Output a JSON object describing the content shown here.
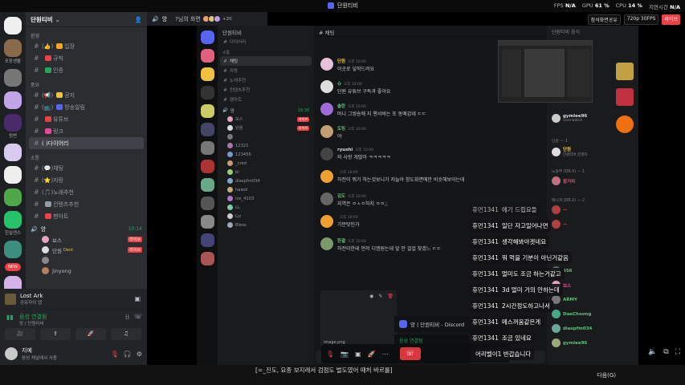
{
  "window": {
    "title": "단원티비"
  },
  "perf": {
    "fps_label": "FPS",
    "fps_value": "N/A",
    "gpu_label": "GPU",
    "gpu_value": "61 %",
    "cpu_label": "CPU",
    "cpu_value": "14 %",
    "latency_label": "지연시간",
    "latency_value": "N/A"
  },
  "stream_overlay": {
    "pill1": "참석화면공유",
    "quality": "720p 30FPS",
    "live": "라이브"
  },
  "left": {
    "server_name": "단원티비",
    "categories": [
      {
        "label": "환영",
        "channels": [
          {
            "name": "입장",
            "prefix": "(👍)"
          },
          {
            "name": "규칙",
            "prefix": ""
          },
          {
            "name": "인증",
            "prefix": ""
          }
        ]
      },
      {
        "label": "중요",
        "channels": [
          {
            "name": "공지",
            "prefix": "(📢)"
          },
          {
            "name": "방송알림",
            "prefix": "(📺)"
          },
          {
            "name": "유튜브",
            "prefix": ""
          },
          {
            "name": "링크",
            "prefix": ""
          },
          {
            "name": "다이어리",
            "prefix": "( )"
          }
        ]
      },
      {
        "label": "소통",
        "channels": [
          {
            "name": "채팅",
            "prefix": "(💬)"
          },
          {
            "name": "자랑",
            "prefix": "(⭐)"
          },
          {
            "name": "노래추천",
            "prefix": "(🎵)"
          },
          {
            "name": "컨텐츠추천",
            "prefix": ""
          },
          {
            "name": "팬아트",
            "prefix": ""
          }
        ]
      }
    ],
    "voice_channel": {
      "name": "앙",
      "time": "10:14"
    },
    "voice_members": [
      {
        "name": "보스",
        "live": "라이브"
      },
      {
        "name": "단원",
        "tag": "Dent",
        "live": "라이브"
      },
      {
        "name": "",
        "live": ""
      },
      {
        "name": "jinyong",
        "live": ""
      }
    ],
    "server_labels": [
      "포장생활",
      "림변",
      "힌실엔스"
    ],
    "new_badge": "NEW"
  },
  "activity": {
    "game": "Lost Ark",
    "status": "공유자의 앱",
    "voice_title": "음성 연결됨",
    "voice_sub": "앙 / 단원티비"
  },
  "user": {
    "name": "지예",
    "status": "음성 채널에서 사용"
  },
  "tab": {
    "title": "앙",
    "streamer": "?님의 화면",
    "count": "+20"
  },
  "stream": {
    "server_name": "단원티비",
    "channels_top": [
      "다이어리"
    ],
    "cat_label": "소통",
    "channels": [
      "채팅",
      "자랑",
      "노래추천",
      "컨텐츠추천",
      "팬아트"
    ],
    "voice_name": "앙",
    "voice_time": "19:38",
    "voice_members": [
      "보스",
      "단원",
      "",
      "12321",
      "123456",
      "_cred",
      "bi",
      "diaspfm034",
      "hawol",
      "ice_4103",
      "LL",
      "Liz",
      "Bless"
    ],
    "chat_header": "채팅",
    "messages": [
      {
        "name": "단원",
        "time": "오후 10:00",
        "text": "이곳로 넣작드려요"
      },
      {
        "name": "슈",
        "time": "오후 10:00",
        "text": "단원 유튜브 구독과 좋아요"
      },
      {
        "name": "솔란",
        "time": "오후 10:00",
        "text": "머니 그씽숑에 지 핸서바는 또 동예갑네 ㄷㄷ"
      },
      {
        "name": "도밍",
        "time": "오후 10:00",
        "text": "야"
      },
      {
        "name": "ryushi",
        "time": "오후 10:00",
        "text": "와 사랑 개많아 ㅋㅋㅋㅋㅋ"
      },
      {
        "name": "",
        "time": "오후 10:00",
        "text": "하전이 뭐가 하는것보니가 저늘야 창도화면에만 비슷해보이는데"
      },
      {
        "name": "김도",
        "time": "오후 10:00",
        "text": "지역은 ㅇㅅㅇ하지 ㅇㅇ;;"
      },
      {
        "name": "",
        "time": "오후 10:00",
        "text": "기분탓인가"
      },
      {
        "name": "한결",
        "time": "오후 10:00",
        "text": "하전이한테 먼저 디엠원는데 앞 안 걸걸 찾겠느 ㄷㄷ"
      }
    ],
    "attachment": "image.png",
    "popup": "앙 | 단원티비 - Discord",
    "voice_bar_title": "음성 연결됨",
    "voice_bar_sub": "앙 / 단원티비",
    "members_header": "단원티비 음식",
    "member_sections": [
      {
        "label": "",
        "members": [
          {
            "name": "gymlee96",
            "sub": "Overwatch"
          }
        ]
      },
      {
        "label": "단원 — 1",
        "members": [
          {
            "name": "단원",
            "sub": "단원티비 운영자"
          }
        ]
      },
      {
        "label": "노동부 (DR.X) — 1",
        "members": [
          {
            "name": "장기미",
            "sub": ""
          }
        ]
      },
      {
        "label": "매니저 (DR.X) — 2",
        "members": [
          {
            "name": "",
            "sub": ""
          },
          {
            "name": "",
            "sub": ""
          }
        ]
      },
      {
        "label": "",
        "members": [
          {
            "name": "456",
            "sub": ""
          },
          {
            "name": "보스",
            "sub": ""
          },
          {
            "name": "ARMY",
            "sub": ""
          },
          {
            "name": "DaeChoong",
            "sub": ""
          },
          {
            "name": "diaspfm034",
            "sub": ""
          },
          {
            "name": "gymlee96",
            "sub": ""
          }
        ]
      }
    ]
  },
  "overlay_chat": [
    {
      "user": "휴먼1341",
      "text": "에기 드립요들"
    },
    {
      "user": "휴먼1341",
      "text": "일단 자고일어나면"
    },
    {
      "user": "휴먼1341",
      "text": "생각해봐야겟네요"
    },
    {
      "user": "휴먼1341",
      "text": "뭐 먹을 기분이 아닌거같음"
    },
    {
      "user": "휴먼1341",
      "text": "멀미도 조금 하는거같고"
    },
    {
      "user": "휴먼1341",
      "text": "3d 멀미 거의 안하는데"
    },
    {
      "user": "휴먼1341",
      "text": "2시간정도하고나서"
    },
    {
      "user": "휴먼1341",
      "text": "메스꺼움같은게"
    },
    {
      "user": "휴먼1341",
      "text": "조금 있네요"
    },
    {
      "user": "",
      "text": "어리벨이1 반갑습니다"
    }
  ],
  "subtitle": {
    "caption": "[=_진도, 요종 보지레서 검점도 벌도였어 때처 바르를]",
    "next": "다음(G)"
  }
}
